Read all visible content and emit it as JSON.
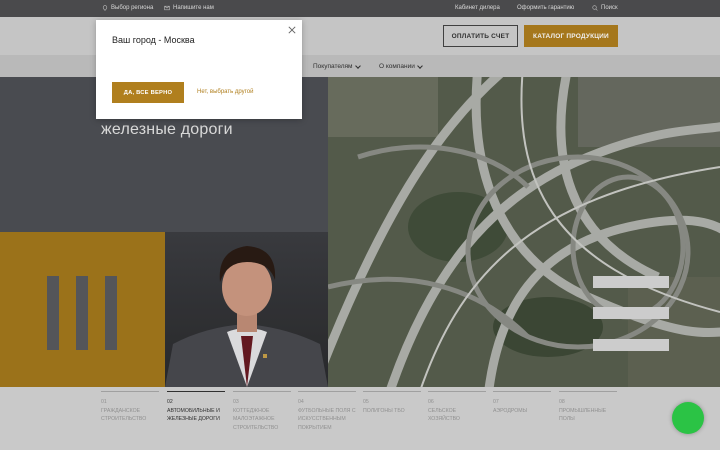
{
  "topbar": {
    "region": "Выбор региона",
    "write_us": "Напишите нам",
    "dealer": "Кабинет дилера",
    "warranty": "Оформить гарантию",
    "search": "Поиск"
  },
  "header": {
    "pay_label": "ОПЛАТИТЬ СЧЕТ",
    "catalog_label": "КАТАЛОГ ПРОДУКЦИИ"
  },
  "nav": {
    "items": [
      {
        "label": "Покупателям"
      },
      {
        "label": "О компании"
      }
    ]
  },
  "hero": {
    "title": "железные дороги"
  },
  "tabs": [
    {
      "num": "01",
      "label": "ГРАЖДАНСКОЕ СТРОИТЕЛЬСТВО"
    },
    {
      "num": "02",
      "label": "АВТОМОБИЛЬНЫЕ И ЖЕЛЕЗНЫЕ ДОРОГИ"
    },
    {
      "num": "03",
      "label": "КОТТЕДЖНОЕ МАЛОЭТАЖНОЕ СТРОИТЕЛЬСТВО"
    },
    {
      "num": "04",
      "label": "ФУТБОЛЬНЫЕ ПОЛЯ С ИСКУССТВЕННЫМ ПОКРЫТИЕМ"
    },
    {
      "num": "05",
      "label": "ПОЛИГОНЫ ТБО"
    },
    {
      "num": "06",
      "label": "СЕЛЬСКОЕ ХОЗЯЙСТВО"
    },
    {
      "num": "07",
      "label": "АЭРОДРОМЫ"
    },
    {
      "num": "08",
      "label": "ПРОМЫШЛЕННЫЕ ПОЛЫ"
    }
  ],
  "active_tab": 1,
  "modal": {
    "title": "Ваш город - Москва",
    "confirm_label": "ДА, ВСЕ ВЕРНО",
    "other_label": "Нет, выбрать другой"
  },
  "colors": {
    "gold": "#b07f1e",
    "dark": "#4a4a4c",
    "chat": "#2ed04a"
  }
}
